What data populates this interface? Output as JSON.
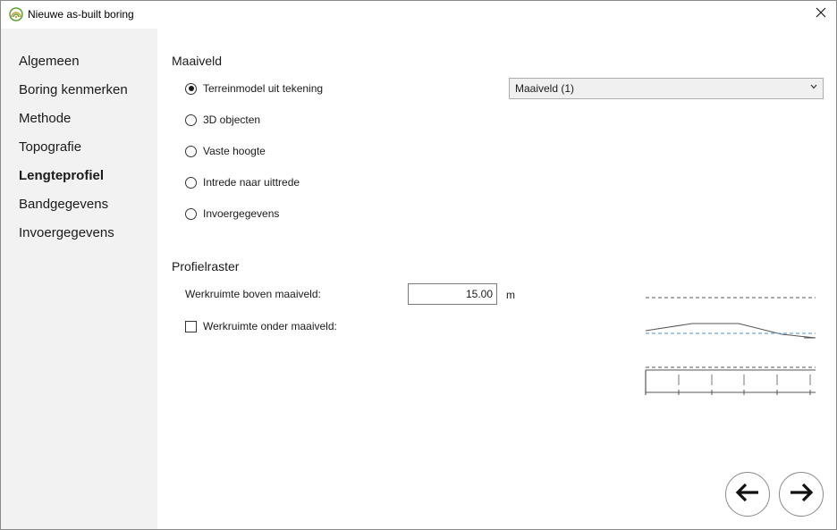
{
  "window": {
    "title": "Nieuwe as-built boring",
    "app_icon": "app-logo-icon",
    "close_icon": "close-icon"
  },
  "sidebar": {
    "items": [
      {
        "label": "Algemeen",
        "active": false
      },
      {
        "label": "Boring kenmerken",
        "active": false
      },
      {
        "label": "Methode",
        "active": false
      },
      {
        "label": "Topografie",
        "active": false
      },
      {
        "label": "Lengteprofiel",
        "active": true
      },
      {
        "label": "Bandgegevens",
        "active": false
      },
      {
        "label": "Invoergegevens",
        "active": false
      }
    ]
  },
  "maaiveld": {
    "title": "Maaiveld",
    "options": [
      {
        "label": "Terreinmodel uit tekening",
        "checked": true
      },
      {
        "label": "3D objecten",
        "checked": false
      },
      {
        "label": "Vaste hoogte",
        "checked": false
      },
      {
        "label": "Intrede naar uittrede",
        "checked": false
      },
      {
        "label": "Invoergegevens",
        "checked": false
      }
    ],
    "select_value": "Maaiveld (1)"
  },
  "profielraster": {
    "title": "Profielraster",
    "werkruimte_boven_label": "Werkruimte boven maaiveld:",
    "werkruimte_boven_value": "15.00",
    "unit": "m",
    "werkruimte_onder_label": "Werkruimte onder maaiveld:",
    "werkruimte_onder_checked": false
  },
  "navigation": {
    "back_icon": "arrow-left-icon",
    "next_icon": "arrow-right-icon"
  },
  "colors": {
    "sidebar_bg": "#f2f2f2",
    "accent_line": "#4a8fd1"
  }
}
